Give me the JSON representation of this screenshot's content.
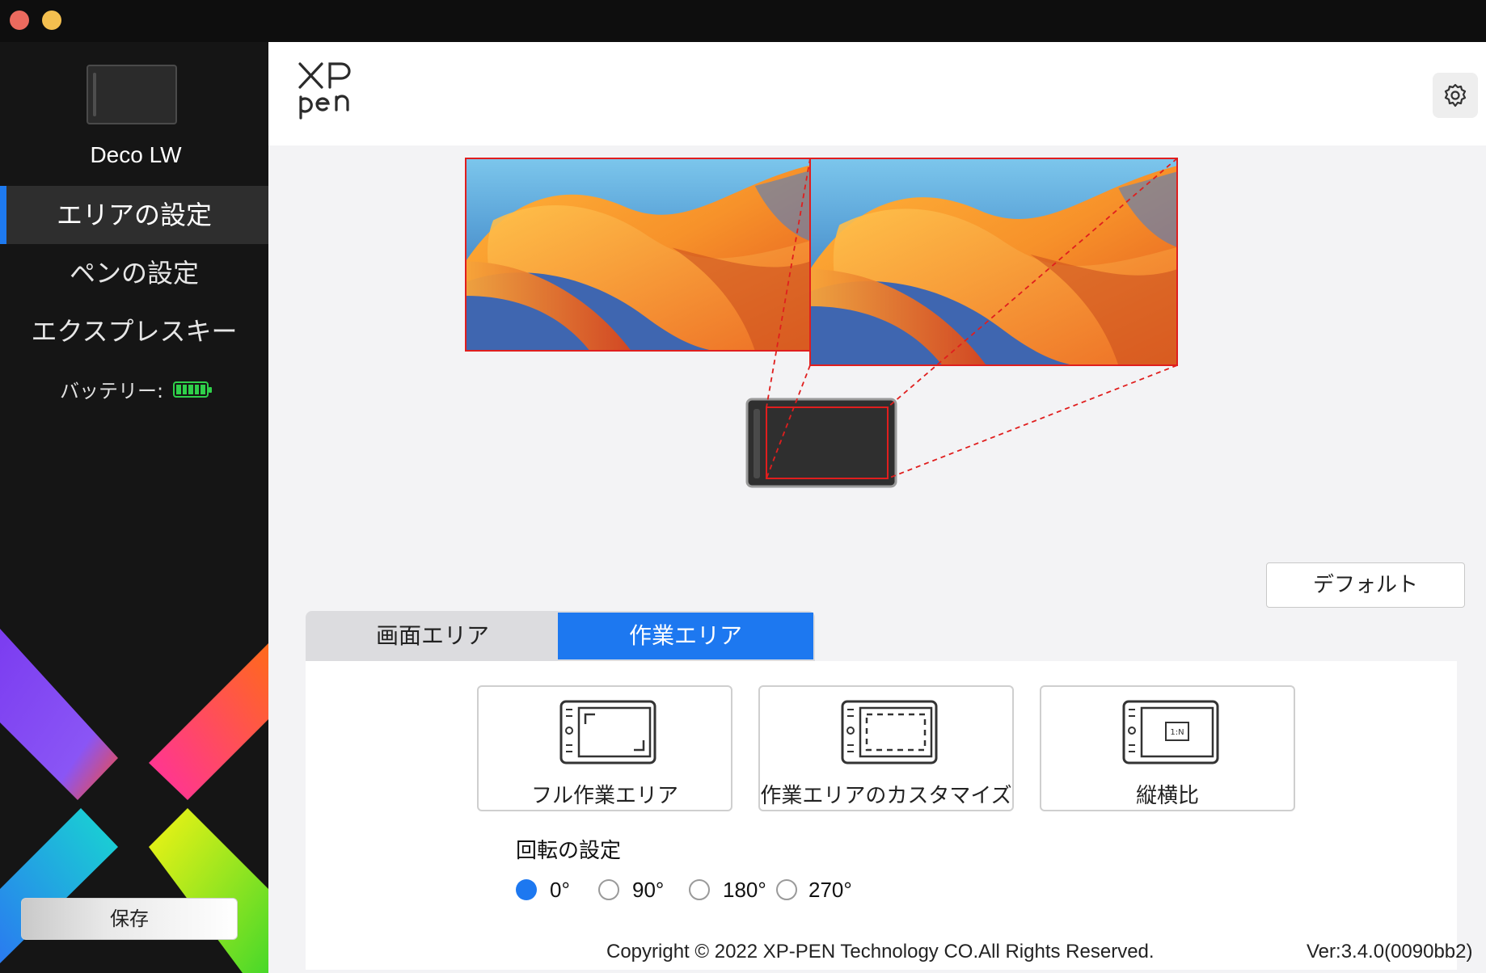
{
  "window": {
    "controls": [
      "close",
      "minimize"
    ]
  },
  "sidebar": {
    "device_name": "Deco LW",
    "nav": [
      {
        "label": "エリアの設定",
        "active": true
      },
      {
        "label": "ペンの設定",
        "active": false
      },
      {
        "label": "エクスプレスキー",
        "active": false
      }
    ],
    "battery_label": "バッテリー:",
    "battery_level": 1.0,
    "save_label": "保存"
  },
  "header": {
    "logo_text": "XP pen",
    "settings_icon": "gear-icon"
  },
  "mapping": {
    "monitors": 2,
    "default_label": "デフォルト"
  },
  "tabs": [
    {
      "label": "画面エリア",
      "active": false
    },
    {
      "label": "作業エリア",
      "active": true
    }
  ],
  "work_area_options": [
    {
      "label": "フル作業エリア",
      "icon": "full-area-icon"
    },
    {
      "label": "作業エリアのカスタマイズ",
      "icon": "custom-area-icon"
    },
    {
      "label": "縦横比",
      "icon": "aspect-ratio-icon"
    }
  ],
  "rotation": {
    "title": "回転の設定",
    "options": [
      "0°",
      "90°",
      "180°",
      "270°"
    ],
    "selected": "0°"
  },
  "footer": {
    "copyright": "Copyright © 2022  XP-PEN Technology CO.All Rights Reserved.",
    "version": "Ver:3.4.0(0090bb2)"
  },
  "colors": {
    "accent": "#1d78f0",
    "mapping_line": "#e01e1e",
    "battery": "#2fd04a"
  }
}
